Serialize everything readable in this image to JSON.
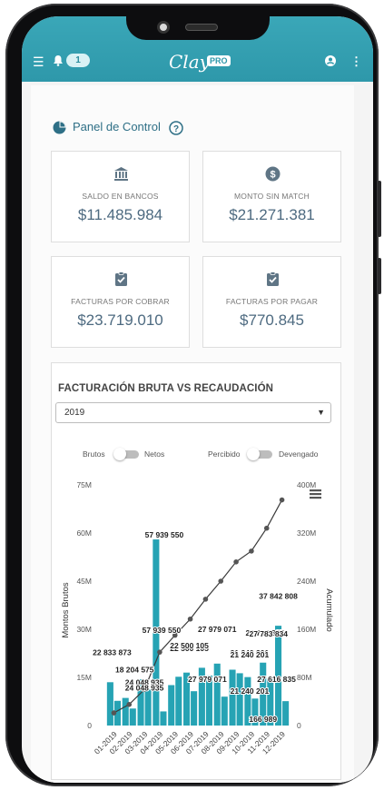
{
  "topbar": {
    "notifications_count": "1",
    "logo_text": "Clay",
    "logo_badge": "PRO"
  },
  "panel": {
    "title": "Panel de Control"
  },
  "kpis": [
    {
      "label": "SALDO EN BANCOS",
      "value": "$11.485.984",
      "icon": "bank-icon"
    },
    {
      "label": "MONTO SIN MATCH",
      "value": "$21.271.381",
      "icon": "dollar-icon"
    },
    {
      "label": "FACTURAS POR COBRAR",
      "value": "$23.719.010",
      "icon": "clipboard-check-icon"
    },
    {
      "label": "FACTURAS POR PAGAR",
      "value": "$770.845",
      "icon": "clipboard-check-icon"
    }
  ],
  "chart_card": {
    "title": "FACTURACIÓN BRUTA VS RECAUDACIÓN",
    "year_select": "2019",
    "toggle1_left": "Brutos",
    "toggle1_right": "Netos",
    "toggle2_left": "Percibido",
    "toggle2_right": "Devengado"
  },
  "colors": {
    "accent": "#2e98aa",
    "bar": "#26a3b4",
    "line": "#3a3a3a"
  },
  "chart_data": {
    "type": "bar",
    "categories": [
      "01-2019",
      "02-2019",
      "03-2019",
      "04-2019",
      "05-2019",
      "06-2019",
      "07-2019",
      "08-2019",
      "09-2019",
      "10-2019",
      "11-2019",
      "12-2019"
    ],
    "series": [
      {
        "name": "",
        "values": [
          13.5,
          8.6,
          14.4,
          58.0,
          12.6,
          16.5,
          18.0,
          19.3,
          17.4,
          15.1,
          19.6,
          31.1
        ]
      },
      {
        "name": "",
        "values": [
          7.7,
          5.3,
          11.2,
          4.4,
          15.2,
          10.7,
          15.6,
          9.0,
          16.3,
          8.4,
          14.5,
          7.6
        ]
      },
      {
        "name": "Acumulado",
        "values": [
          21,
          35,
          60,
          122,
          150,
          177,
          210,
          240,
          272,
          290,
          328,
          375
        ]
      }
    ],
    "data_labels": [
      "22 833 873",
      "18 204 575",
      "24 048 935",
      "57 939 550",
      "22 500 105",
      "27 979 071",
      "21 240 201",
      "27 783 835",
      "37 842 808",
      "166 989"
    ],
    "labels_bottom_row": [
      "57 939 550",
      "27 979 071",
      "22 500 105",
      "21 240 201",
      "27 783 834"
    ],
    "labels_lower_row": [
      "24 048 935",
      "27 979 071",
      "21 240 201",
      "27 616 835"
    ],
    "ylabel_left": "Montos Brutos",
    "ylabel_right": "Acumulado",
    "yticks_left": [
      "0",
      "15M",
      "30M",
      "45M",
      "60M",
      "75M"
    ],
    "yticks_right": [
      "0",
      "80M",
      "160M",
      "240M",
      "320M",
      "400M"
    ],
    "ylim_left": [
      0,
      75
    ],
    "ylim_right": [
      0,
      400
    ]
  }
}
